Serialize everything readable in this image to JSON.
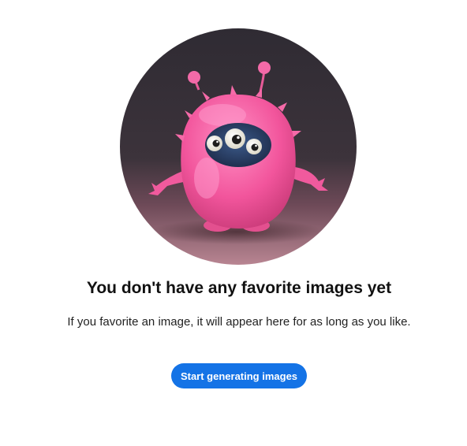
{
  "empty_state": {
    "illustration": "pink-fluffy-three-eyed-monster",
    "title": "You don't have any favorite images yet",
    "subtitle": "If you favorite an image, it will appear here for as long as you like.",
    "cta_label": "Start generating images"
  },
  "colors": {
    "accent": "#1473e6",
    "background": "#ffffff",
    "text": "#111111"
  }
}
